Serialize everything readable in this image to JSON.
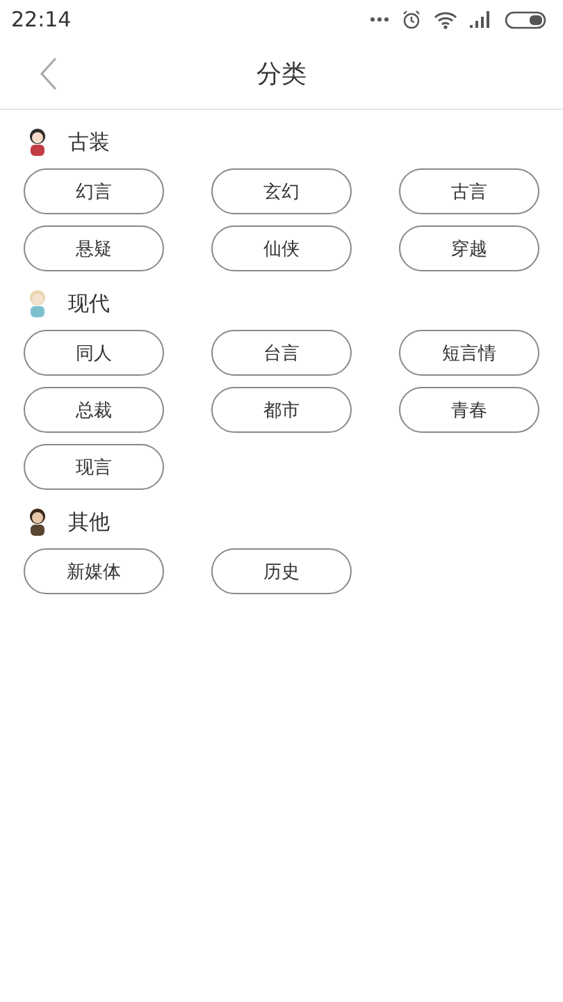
{
  "status_bar": {
    "time": "22:14"
  },
  "header": {
    "title": "分类"
  },
  "sections": [
    {
      "kind": "ancient",
      "title": "古装",
      "tags": [
        "幻言",
        "玄幻",
        "古言",
        "悬疑",
        "仙侠",
        "穿越"
      ]
    },
    {
      "kind": "modern",
      "title": "现代",
      "tags": [
        "同人",
        "台言",
        "短言情",
        "总裁",
        "都市",
        "青春",
        "现言"
      ]
    },
    {
      "kind": "other",
      "title": "其他",
      "tags": [
        "新媒体",
        "历史"
      ]
    }
  ]
}
